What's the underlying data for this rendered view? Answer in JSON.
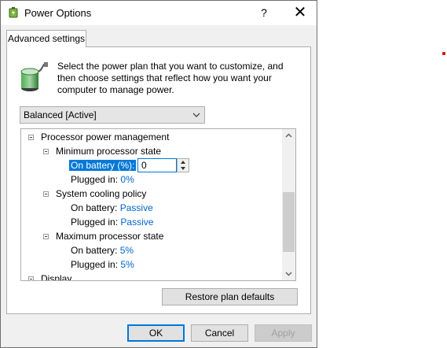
{
  "window": {
    "title": "Power Options",
    "help_label": "?",
    "close_label": "✕"
  },
  "tab": {
    "label": "Advanced settings"
  },
  "description": "Select the power plan that you want to customize, and then choose settings that reflect how you want your computer to manage power.",
  "plan_select": {
    "value": "Balanced [Active]"
  },
  "tree": {
    "processor_power_management": "Processor power management",
    "min_state": {
      "label": "Minimum processor state",
      "on_battery_label": "On battery (%):",
      "on_battery_value": "0",
      "plugged_in_label": "Plugged in:",
      "plugged_in_value": "0%"
    },
    "cooling": {
      "label": "System cooling policy",
      "on_battery_label": "On battery:",
      "on_battery_value": "Passive",
      "plugged_in_label": "Plugged in:",
      "plugged_in_value": "Passive"
    },
    "max_state": {
      "label": "Maximum processor state",
      "on_battery_label": "On battery:",
      "on_battery_value": "5%",
      "plugged_in_label": "Plugged in:",
      "plugged_in_value": "5%"
    },
    "display": "Display"
  },
  "buttons": {
    "restore": "Restore plan defaults",
    "ok": "OK",
    "cancel": "Cancel",
    "apply": "Apply"
  },
  "colors": {
    "accent": "#0078d7",
    "link": "#0066cc"
  }
}
